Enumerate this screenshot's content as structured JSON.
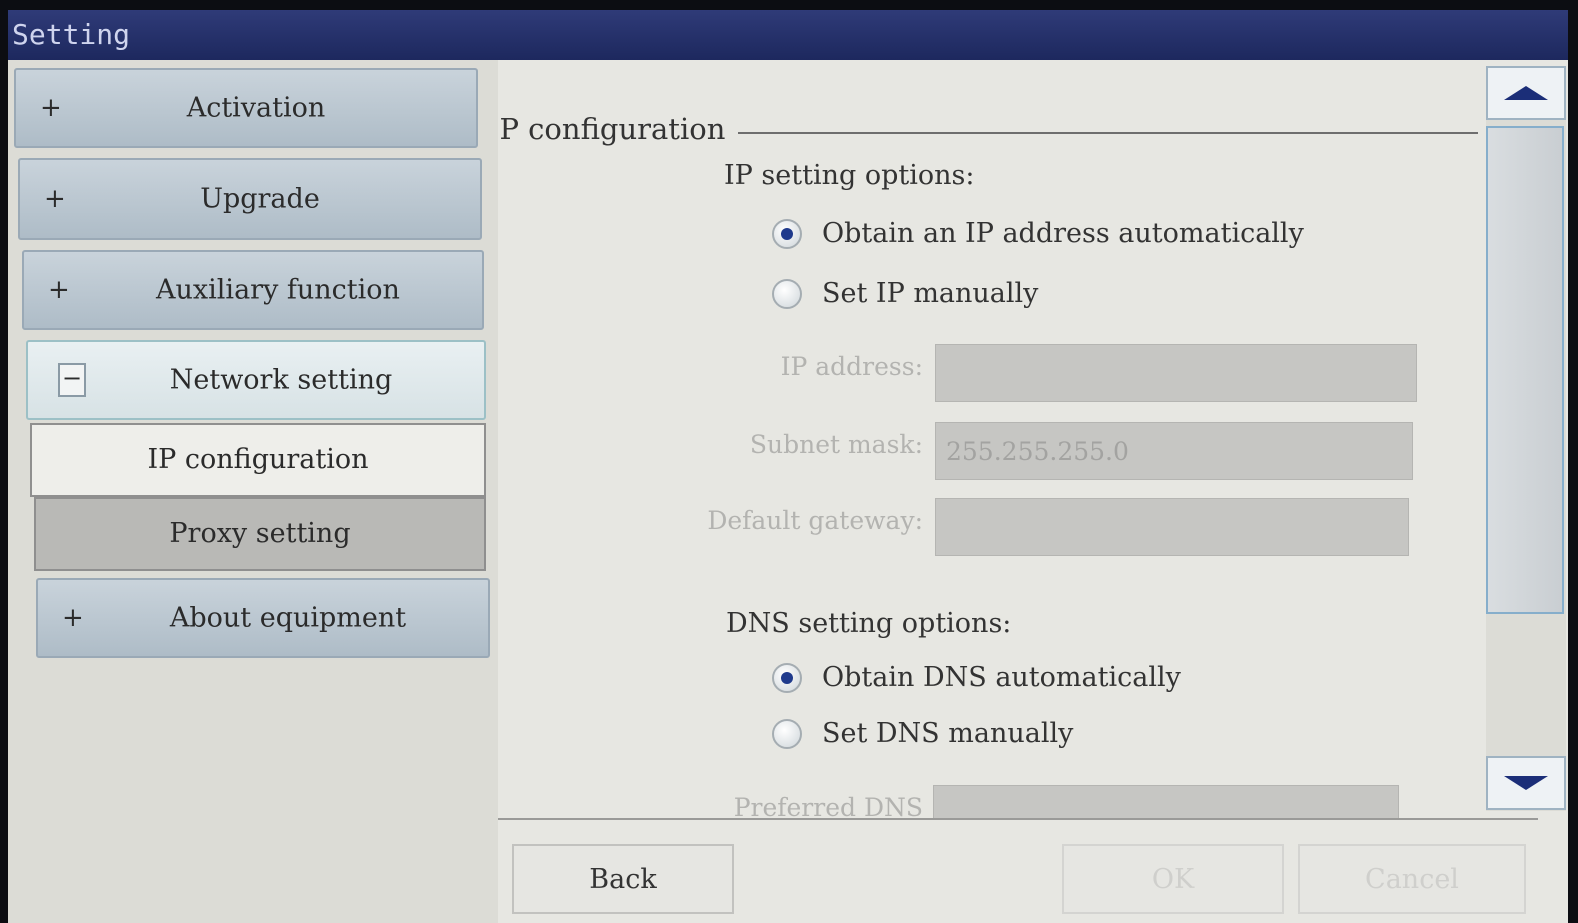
{
  "window": {
    "title": "Setting"
  },
  "sidebar": {
    "items": [
      {
        "label": "Activation",
        "sign": "+"
      },
      {
        "label": "Upgrade",
        "sign": "+"
      },
      {
        "label": "Auxiliary function",
        "sign": "+"
      },
      {
        "label": "Network setting",
        "sign": "−",
        "expanded": true,
        "children": [
          {
            "label": "IP configuration",
            "active": true
          },
          {
            "label": "Proxy setting",
            "active": false
          }
        ]
      },
      {
        "label": "About equipment",
        "sign": "+"
      }
    ]
  },
  "content": {
    "group_title": "IP configuration",
    "ip_section": {
      "title": "IP setting options:",
      "options": [
        {
          "label": "Obtain an IP address automatically",
          "selected": true
        },
        {
          "label": "Set IP manually",
          "selected": false
        }
      ],
      "fields": [
        {
          "label": "IP address:",
          "value": ""
        },
        {
          "label": "Subnet mask:",
          "value": "255.255.255.0"
        },
        {
          "label": "Default gateway:",
          "value": ""
        }
      ]
    },
    "dns_section": {
      "title": "DNS setting options:",
      "options": [
        {
          "label": "Obtain DNS automatically",
          "selected": true
        },
        {
          "label": "Set DNS manually",
          "selected": false
        }
      ],
      "fields": [
        {
          "label": "Preferred DNS server:",
          "value": ""
        }
      ]
    }
  },
  "footer": {
    "back_label": "Back",
    "ok_label": "OK",
    "cancel_label": "Cancel"
  },
  "colors": {
    "title_bar": "#1d285e",
    "radio_selected": "#1f3a8c",
    "scroll_arrow": "#1b2e78"
  }
}
